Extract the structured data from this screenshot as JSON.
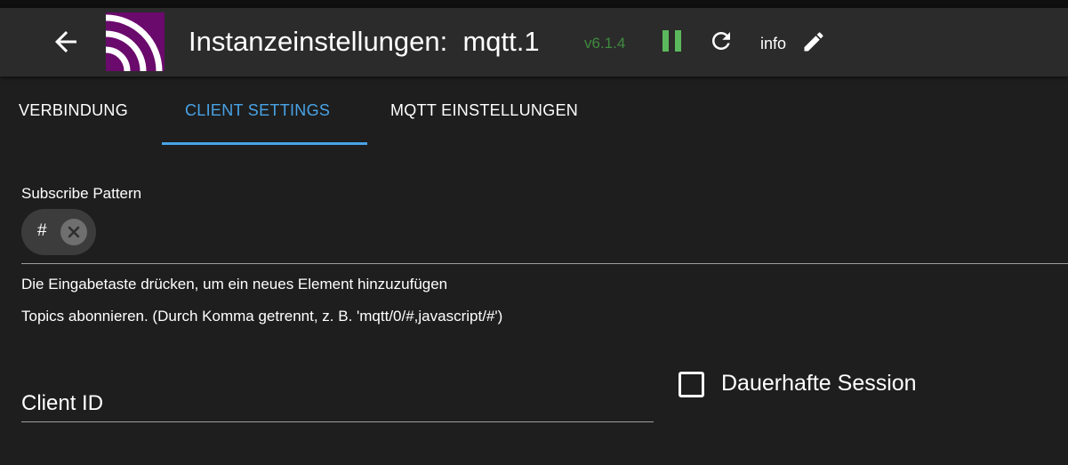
{
  "header": {
    "title": "Instanzeinstellungen:  mqtt.1",
    "version": "v6.1.4",
    "info_label": "info",
    "icons": {
      "back": "arrow-left-icon",
      "pause": "pause-icon",
      "reload": "reload-icon",
      "edit": "pencil-icon",
      "logo": "mqtt-adapter-logo"
    },
    "colors": {
      "version": "#3f8a3f",
      "pause": "#5cb85c",
      "logo_bg": "#6a0a6c"
    }
  },
  "tabs": [
    {
      "label": "VERBINDUNG",
      "active": false
    },
    {
      "label": "CLIENT SETTINGS",
      "active": true
    },
    {
      "label": "MQTT EINSTELLUNGEN",
      "active": false
    }
  ],
  "accent_color": "#48a3e6",
  "subscribe": {
    "label": "Subscribe Pattern",
    "chips": [
      "#"
    ],
    "helper_enter": "Die Eingabetaste drücken, um ein neues Element hinzuzufügen",
    "helper_topics": "Topics abonnieren. (Durch Komma getrennt, z. B. 'mqtt/0/#,javascript/#')"
  },
  "client_id": {
    "placeholder": "Client ID",
    "value": ""
  },
  "persistent_session": {
    "label": "Dauerhafte Session",
    "checked": false
  }
}
